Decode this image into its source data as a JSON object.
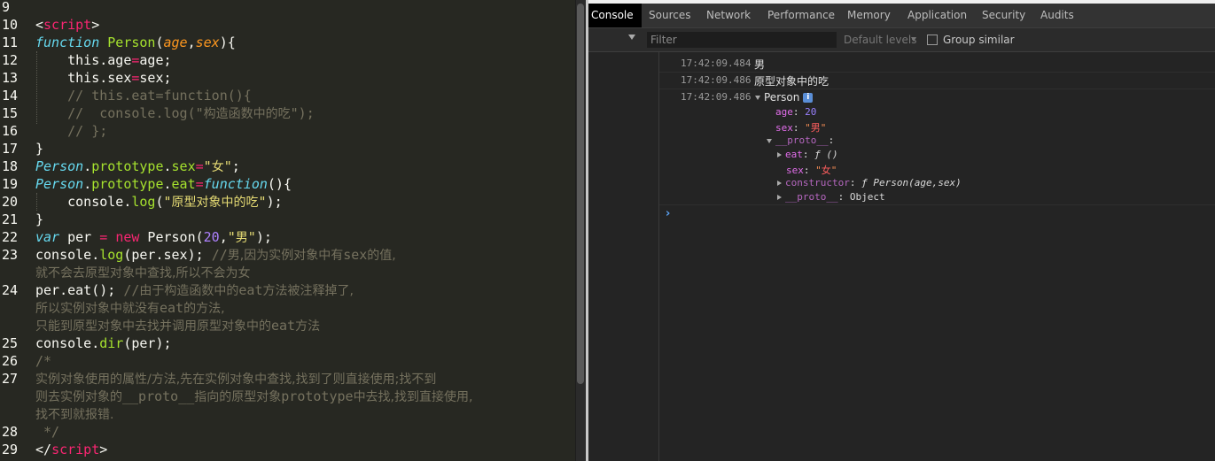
{
  "editor": {
    "lines": [
      {
        "n": "9",
        "tokens": []
      },
      {
        "n": "10",
        "tokens": [
          [
            "",
            "<"
          ],
          [
            "tag",
            "script"
          ],
          [
            "",
            ">"
          ]
        ]
      },
      {
        "n": "11",
        "tokens": [
          [
            "kw-i",
            "function"
          ],
          [
            "",
            " "
          ],
          [
            "fn",
            "Person"
          ],
          [
            "",
            "("
          ],
          [
            "param",
            "age"
          ],
          [
            "",
            ","
          ],
          [
            "param",
            "sex"
          ],
          [
            "",
            "){"
          ]
        ]
      },
      {
        "n": "12",
        "tokens": [
          [
            "",
            "    this.age"
          ],
          [
            "op",
            "="
          ],
          [
            "",
            "age;"
          ]
        ]
      },
      {
        "n": "13",
        "tokens": [
          [
            "",
            "    this.sex"
          ],
          [
            "op",
            "="
          ],
          [
            "",
            "sex;"
          ]
        ]
      },
      {
        "n": "14",
        "tokens": [
          [
            "cm",
            "    // this.eat=function(){"
          ]
        ]
      },
      {
        "n": "15",
        "tokens": [
          [
            "cm",
            "    //  console.log(\""
          ],
          [
            "cm cn",
            "构造函数中的吃"
          ],
          [
            "cm",
            "\");"
          ]
        ]
      },
      {
        "n": "16",
        "tokens": [
          [
            "cm",
            "    // };"
          ]
        ]
      },
      {
        "n": "17",
        "tokens": [
          [
            "",
            "}"
          ]
        ]
      },
      {
        "n": "18",
        "tokens": [
          [
            "cls-i",
            "Person"
          ],
          [
            "",
            "."
          ],
          [
            "prop",
            "prototype"
          ],
          [
            "",
            "."
          ],
          [
            "prop",
            "sex"
          ],
          [
            "op",
            "="
          ],
          [
            "str",
            "\""
          ],
          [
            "str cn",
            "女"
          ],
          [
            "str",
            "\""
          ],
          [
            "",
            ";"
          ]
        ]
      },
      {
        "n": "19",
        "tokens": [
          [
            "cls-i",
            "Person"
          ],
          [
            "",
            "."
          ],
          [
            "prop",
            "prototype"
          ],
          [
            "",
            "."
          ],
          [
            "prop",
            "eat"
          ],
          [
            "op",
            "="
          ],
          [
            "kw-i",
            "function"
          ],
          [
            "",
            "(){"
          ]
        ]
      },
      {
        "n": "20",
        "tokens": [
          [
            "",
            "    console."
          ],
          [
            "fn",
            "log"
          ],
          [
            "",
            "("
          ],
          [
            "str",
            "\""
          ],
          [
            "str cn",
            "原型对象中的吃"
          ],
          [
            "str",
            "\""
          ],
          [
            "",
            ");"
          ]
        ]
      },
      {
        "n": "21",
        "tokens": [
          [
            "",
            "}"
          ]
        ]
      },
      {
        "n": "22",
        "tokens": [
          [
            "kw-i",
            "var"
          ],
          [
            "",
            " per "
          ],
          [
            "op",
            "="
          ],
          [
            "",
            " "
          ],
          [
            "kw",
            "new"
          ],
          [
            "",
            " Person("
          ],
          [
            "num",
            "20"
          ],
          [
            "",
            ","
          ],
          [
            "str",
            "\""
          ],
          [
            "str cn",
            "男"
          ],
          [
            "str",
            "\""
          ],
          [
            "",
            ");"
          ]
        ]
      },
      {
        "n": "23",
        "tokens": [
          [
            "",
            "console."
          ],
          [
            "fn",
            "log"
          ],
          [
            "",
            "(per.sex); "
          ],
          [
            "cm",
            "//"
          ],
          [
            "cm cn",
            "男,因为实例对象中有"
          ],
          [
            "cm",
            "sex"
          ],
          [
            "cm cn",
            "的值,"
          ]
        ]
      },
      {
        "n": "",
        "tokens": [
          [
            "cm cn",
            "就不会去原型对象中查找,所以不会为女"
          ]
        ]
      },
      {
        "n": "24",
        "tokens": [
          [
            "",
            "per.eat(); "
          ],
          [
            "cm",
            "//"
          ],
          [
            "cm cn",
            "由于构造函数中的"
          ],
          [
            "cm",
            "eat"
          ],
          [
            "cm cn",
            "方法被注释掉了,"
          ]
        ]
      },
      {
        "n": "",
        "tokens": [
          [
            "cm cn",
            "所以实例对象中就没有"
          ],
          [
            "cm",
            "eat"
          ],
          [
            "cm cn",
            "的方法,"
          ]
        ]
      },
      {
        "n": "",
        "tokens": [
          [
            "cm cn",
            "只能到原型对象中去找并调用原型对象中的"
          ],
          [
            "cm",
            "eat"
          ],
          [
            "cm cn",
            "方法"
          ]
        ]
      },
      {
        "n": "25",
        "tokens": [
          [
            "",
            "console."
          ],
          [
            "fn",
            "dir"
          ],
          [
            "",
            "(per);"
          ]
        ]
      },
      {
        "n": "26",
        "tokens": [
          [
            "cm",
            "/*"
          ]
        ]
      },
      {
        "n": "27",
        "tokens": [
          [
            "cm cn",
            "实例对象使用的属性/方法,先在实例对象中查找,找到了则直接使用;找不到"
          ]
        ]
      },
      {
        "n": "",
        "tokens": [
          [
            "cm cn",
            "则去实例对象的"
          ],
          [
            "cm",
            "__proto__"
          ],
          [
            "cm cn",
            "指向的原型对象"
          ],
          [
            "cm",
            "prototype"
          ],
          [
            "cm cn",
            "中去找,找到直接使用,"
          ]
        ]
      },
      {
        "n": "",
        "tokens": [
          [
            "cm cn",
            "找不到就报错."
          ]
        ]
      },
      {
        "n": "28",
        "tokens": [
          [
            "cm",
            " */"
          ]
        ]
      },
      {
        "n": "29",
        "tokens": [
          [
            "",
            "</"
          ],
          [
            "tag",
            "script"
          ],
          [
            "",
            ">"
          ]
        ]
      }
    ]
  },
  "devtools": {
    "tabs": [
      "Console",
      "Sources",
      "Network",
      "Performance",
      "Memory",
      "Application",
      "Security",
      "Audits"
    ],
    "active_tab": "Console",
    "filter_placeholder": "Filter",
    "levels_label": "Default levels",
    "group_similar_label": "Group similar",
    "logs": [
      {
        "time": "17:42:09.484",
        "text": "男"
      },
      {
        "time": "17:42:09.486",
        "text": "原型对象中的吃"
      },
      {
        "time": "17:42:09.486",
        "text": "Person"
      }
    ],
    "object_tree": {
      "age_key": "age",
      "age_val": "20",
      "sex_key": "sex",
      "sex_val": "男",
      "proto_key": "__proto__",
      "eat_key": "eat",
      "eat_val": "ƒ ()",
      "psex_key": "sex",
      "psex_val": "女",
      "ctor_key": "constructor",
      "ctor_val": "ƒ Person(age,sex)",
      "pproto_key": "__proto__",
      "pproto_val": "Object"
    },
    "prompt": "›"
  },
  "colors": {
    "editor_bg": "#272822",
    "devtools_bg": "#242424",
    "active_tab_bg": "#000000"
  }
}
